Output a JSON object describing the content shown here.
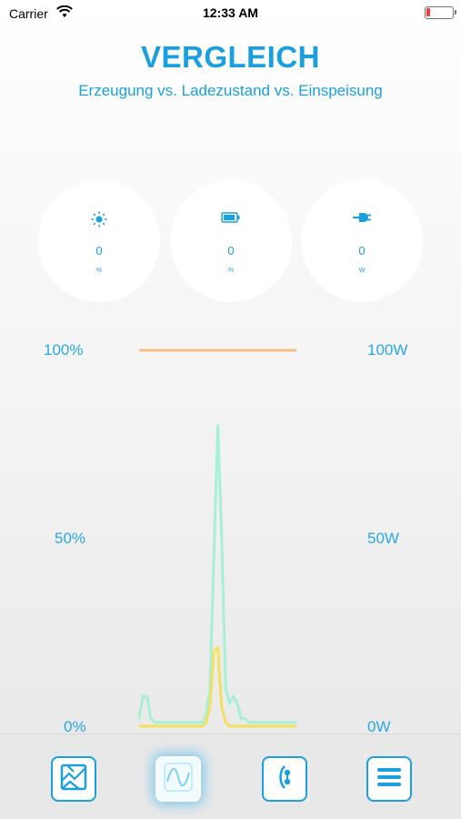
{
  "status_bar": {
    "carrier": "Carrier",
    "time": "12:33 AM"
  },
  "header": {
    "title": "VERGLEICH",
    "subtitle": "Erzeugung vs. Ladezustand vs. Einspeisung"
  },
  "gauges": [
    {
      "icon": "sun-icon",
      "value": "0",
      "unit": "%"
    },
    {
      "icon": "battery-icon",
      "value": "0",
      "unit": "%"
    },
    {
      "icon": "plug-icon",
      "value": "0",
      "unit": "W"
    }
  ],
  "chart_data": {
    "type": "line",
    "left_axis": {
      "ticks": [
        "100%",
        "50%",
        "0%"
      ],
      "ylim": [
        0,
        100
      ]
    },
    "right_axis": {
      "ticks": [
        "100W",
        "50W",
        "0W"
      ],
      "ylim": [
        0,
        100
      ]
    },
    "x": [
      0,
      1,
      2,
      3,
      4,
      5,
      6,
      7,
      8,
      9,
      10,
      11,
      12,
      13,
      14,
      15,
      16,
      17,
      18,
      19,
      20,
      21,
      22,
      23,
      24,
      25,
      26,
      27,
      28,
      29,
      30,
      31,
      32,
      33,
      34,
      35,
      36,
      37,
      38,
      39,
      40
    ],
    "series": [
      {
        "color": "#f5c088",
        "axis": "left",
        "values": [
          100,
          100,
          100,
          100,
          100,
          100,
          100,
          100,
          100,
          100,
          100,
          100,
          100,
          100,
          100,
          100,
          100,
          100,
          100,
          100,
          100,
          100,
          100,
          100,
          100,
          100,
          100,
          100,
          100,
          100,
          100,
          100,
          100,
          100,
          100,
          100,
          100,
          100,
          100,
          100,
          100
        ]
      },
      {
        "color": "#a8f0d4",
        "axis": "right",
        "values": [
          2,
          8,
          8,
          2,
          1,
          1,
          1,
          1,
          1,
          1,
          1,
          1,
          1,
          1,
          1,
          1,
          1,
          3,
          10,
          45,
          80,
          50,
          10,
          6,
          8,
          6,
          2,
          2,
          1,
          1,
          1,
          1,
          1,
          1,
          1,
          1,
          1,
          1,
          1,
          1,
          1
        ]
      },
      {
        "color": "#f4e060",
        "axis": "right",
        "values": [
          0,
          0,
          0,
          0,
          0,
          0,
          0,
          0,
          0,
          0,
          0,
          0,
          0,
          0,
          0,
          0,
          0,
          1,
          5,
          20,
          21,
          5,
          1,
          0,
          0,
          0,
          0,
          0,
          0,
          0,
          0,
          0,
          0,
          0,
          0,
          0,
          0,
          0,
          0,
          0,
          0
        ]
      }
    ]
  },
  "tabs": [
    {
      "icon": "picture-icon",
      "active": false
    },
    {
      "icon": "wave-icon",
      "active": true
    },
    {
      "icon": "connection-icon",
      "active": false
    },
    {
      "icon": "menu-icon",
      "active": false
    }
  ]
}
